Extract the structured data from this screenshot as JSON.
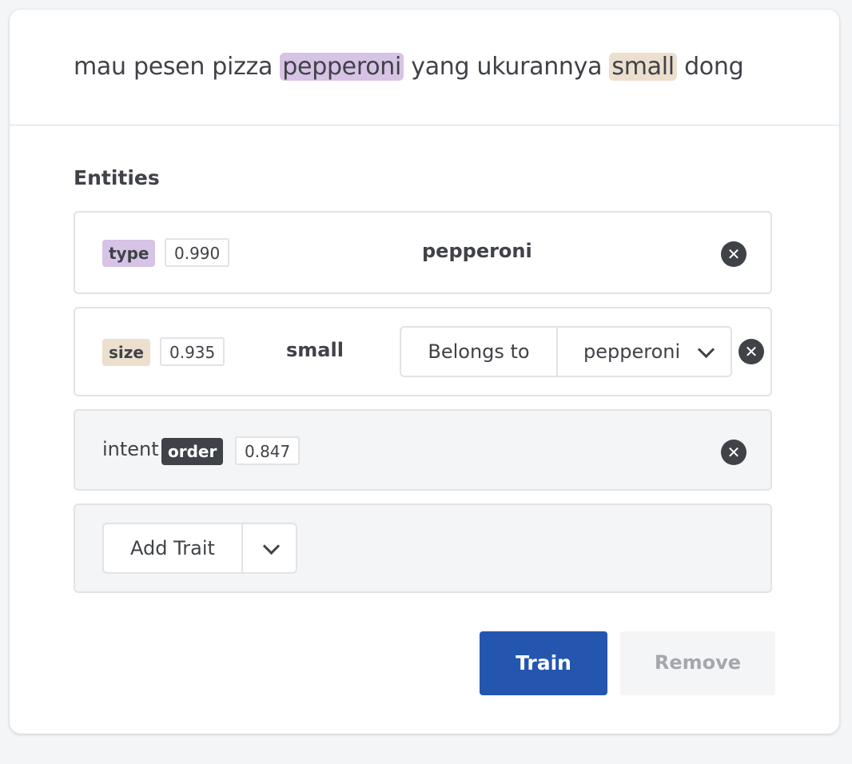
{
  "utterance": {
    "part1": "mau pesen pizza ",
    "entity1": "pepperoni",
    "part2": " yang ukurannya ",
    "entity2": "small",
    "part3": " dong"
  },
  "colors": {
    "type_tag": "#d7c3e5",
    "size_tag": "#ecdfce",
    "intent_tag": "#3f4247",
    "train_button": "#2456b0"
  },
  "entities_section": {
    "title": "Entities",
    "rows": [
      {
        "tag": "type",
        "score": "0.990",
        "value": "pepperoni"
      },
      {
        "tag": "size",
        "score": "0.935",
        "value": "small",
        "belongs_label": "Belongs to",
        "belongs_value": "pepperoni"
      },
      {
        "label": "intent",
        "tag": "order",
        "score": "0.847"
      }
    ],
    "add_trait_label": "Add Trait"
  },
  "actions": {
    "train_label": "Train",
    "remove_label": "Remove"
  },
  "icons": {
    "close": "✕"
  }
}
